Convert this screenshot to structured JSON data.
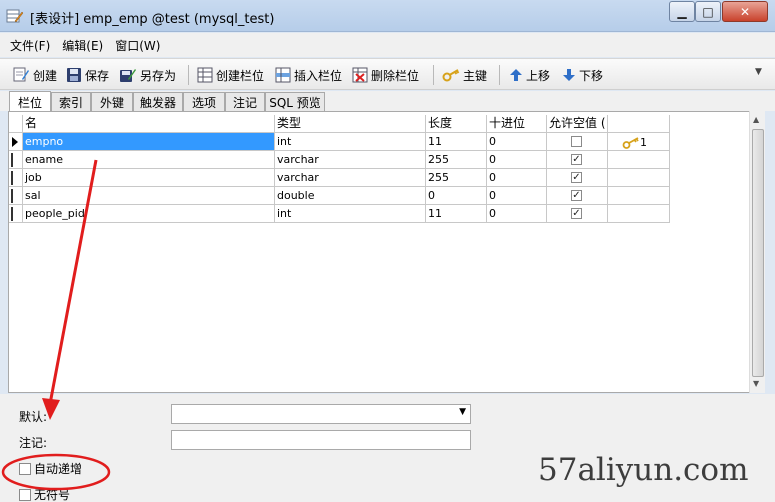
{
  "window": {
    "title": "[表设计] emp_emp @test (mysql_test)",
    "min_glyph": "▁",
    "max_glyph": "□",
    "close_glyph": "✕"
  },
  "menu": [
    "文件(F)",
    "编辑(E)",
    "窗口(W)"
  ],
  "toolbar": {
    "create": "创建",
    "save": "保存",
    "save_as": "另存为",
    "create_field": "创建栏位",
    "insert_field": "插入栏位",
    "delete_field": "删除栏位",
    "primary_key": "主键",
    "move_up": "上移",
    "move_down": "下移"
  },
  "tabs": [
    "栏位",
    "索引",
    "外键",
    "触发器",
    "选项",
    "注记",
    "SQL 预览"
  ],
  "grid": {
    "headers": [
      "名",
      "类型",
      "长度",
      "十进位",
      "允许空值 (",
      ""
    ],
    "rows": [
      {
        "name": "empno",
        "type": "int",
        "length": "11",
        "decimals": "0",
        "nullable": false,
        "key": "1",
        "selected": true
      },
      {
        "name": "ename",
        "type": "varchar",
        "length": "255",
        "decimals": "0",
        "nullable": true,
        "key": "",
        "selected": false
      },
      {
        "name": "job",
        "type": "varchar",
        "length": "255",
        "decimals": "0",
        "nullable": true,
        "key": "",
        "selected": false
      },
      {
        "name": "sal",
        "type": "double",
        "length": "0",
        "decimals": "0",
        "nullable": true,
        "key": "",
        "selected": false
      },
      {
        "name": "people_pid",
        "type": "int",
        "length": "11",
        "decimals": "0",
        "nullable": true,
        "key": "",
        "selected": false
      }
    ]
  },
  "props": {
    "default_label": "默认:",
    "comment_label": "注记:",
    "auto_increment_label": "自动递增",
    "unsigned_label": "无符号",
    "default_value": "",
    "comment_value": ""
  },
  "watermark": "57aliyun.com",
  "colors": {
    "selection": "#3399ff",
    "annotation": "#e11d1d",
    "key_icon": "#d7a21a"
  }
}
